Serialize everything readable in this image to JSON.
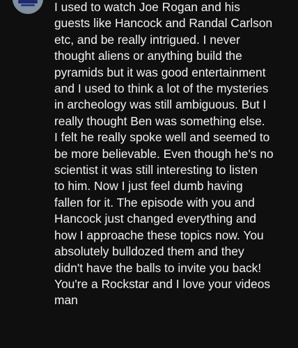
{
  "comment": {
    "avatar_icon": "user-avatar-icon",
    "text_lines": [
      "I used to watch Joe Rogan and his",
      "guests like Hancock and Randal Carlson",
      "etc, and be really intrigued. I never",
      "thought aliens or anything build the",
      "pyramids but it was good entertainment",
      "and I used to think a lot of the mysteries",
      "in archeology was still ambiguous. But I",
      "really thought Ben was something else.",
      "I felt he really spoke well and seemed to",
      "be more believable. Even though he's no",
      "scientist it was still interesting to listen",
      "to him. Now I just feel dumb having",
      "fallen for it. The episode with you and",
      "Hancock just changed everything and",
      "how I approache these topics now. You",
      "absolutely bulldozed them and they",
      "didn't have the balls to invite you back!",
      "You're a Rockstar and I love your videos",
      "man"
    ]
  },
  "colors": {
    "background": "#0f0f0f",
    "text": "#f1f1f1",
    "avatar": "#7f8fa0"
  }
}
